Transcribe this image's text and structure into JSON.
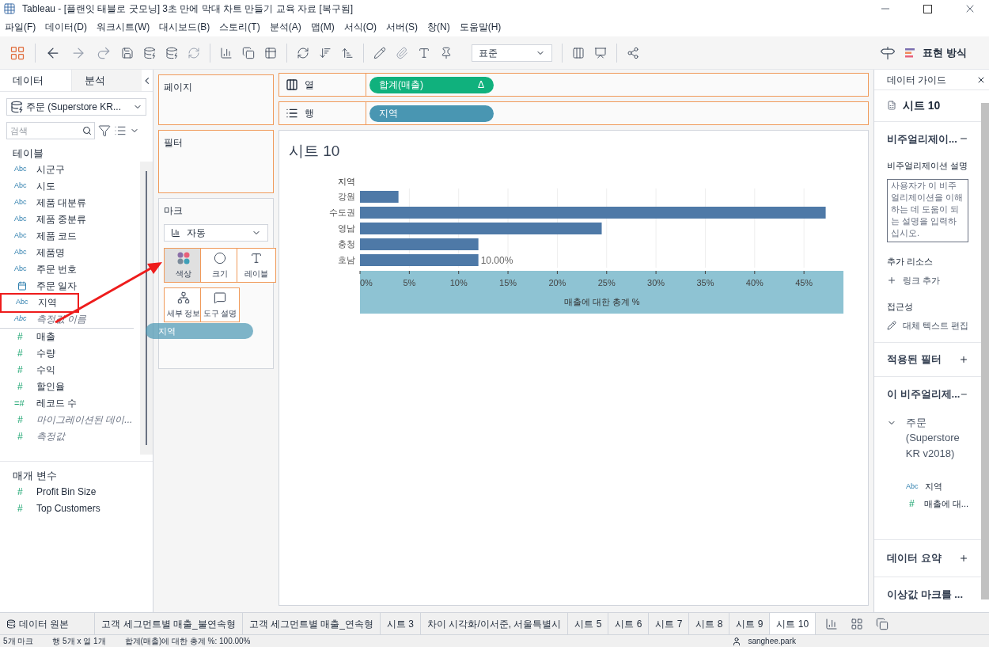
{
  "window": {
    "title": "Tableau - [플랜잇 태블로 굿모닝] 3초 만에 막대 차트 만들기 교육 자료 [복구됨]"
  },
  "menu": [
    "파일(F)",
    "데이터(D)",
    "워크시트(W)",
    "대시보드(B)",
    "스토리(T)",
    "분석(A)",
    "맵(M)",
    "서식(O)",
    "서버(S)",
    "창(N)",
    "도움말(H)"
  ],
  "toolbar": {
    "fit": "표준",
    "show_me": "표현 방식"
  },
  "data_pane": {
    "tabs": [
      {
        "label": "데이터",
        "selected": true
      },
      {
        "label": "분석",
        "selected": false
      }
    ],
    "datasource": "주문 (Superstore KR...",
    "search": {
      "placeholder": "검색"
    },
    "section": "테이블",
    "fields": [
      {
        "kind": "dimension",
        "glyph": "Abc",
        "name": "시군구",
        "italic": false,
        "highlighted": false
      },
      {
        "kind": "dimension",
        "glyph": "Abc",
        "name": "시도",
        "italic": false,
        "highlighted": false
      },
      {
        "kind": "dimension",
        "glyph": "Abc",
        "name": "제품 대분류",
        "italic": false,
        "highlighted": false
      },
      {
        "kind": "dimension",
        "glyph": "Abc",
        "name": "제품 중분류",
        "italic": false,
        "highlighted": false
      },
      {
        "kind": "dimension",
        "glyph": "Abc",
        "name": "제품 코드",
        "italic": false,
        "highlighted": false
      },
      {
        "kind": "dimension",
        "glyph": "Abc",
        "name": "제품명",
        "italic": false,
        "highlighted": false
      },
      {
        "kind": "dimension",
        "glyph": "Abc",
        "name": "주문 번호",
        "italic": false,
        "highlighted": false
      },
      {
        "kind": "date",
        "name": "주문 일자",
        "italic": false,
        "highlighted": false
      },
      {
        "kind": "dimension",
        "glyph": "Abc",
        "name": "지역",
        "italic": false,
        "highlighted": true
      },
      {
        "kind": "dimension",
        "glyph": "Abc",
        "name": "측정값 이름",
        "italic": true,
        "highlighted": false
      },
      {
        "kind": "measure",
        "glyph": "#",
        "name": "매출",
        "italic": false,
        "highlighted": false
      },
      {
        "kind": "measure",
        "glyph": "#",
        "name": "수량",
        "italic": false,
        "highlighted": false
      },
      {
        "kind": "measure",
        "glyph": "#",
        "name": "수익",
        "italic": false,
        "highlighted": false
      },
      {
        "kind": "measure",
        "glyph": "#",
        "name": "할인율",
        "italic": false,
        "highlighted": false
      },
      {
        "kind": "count",
        "glyph": "=#",
        "name": "레코드 수",
        "italic": false,
        "highlighted": false
      },
      {
        "kind": "measure",
        "glyph": "#",
        "name": "마이그레이션된 데이...",
        "italic": true,
        "highlighted": false
      },
      {
        "kind": "measure",
        "glyph": "#",
        "name": "측정값",
        "italic": true,
        "highlighted": false
      }
    ],
    "params_title": "매개 변수",
    "params": [
      {
        "kind": "measure",
        "glyph": "#",
        "name": "Profit Bin Size"
      },
      {
        "kind": "measure",
        "glyph": "#",
        "name": "Top Customers"
      }
    ]
  },
  "shelves": {
    "pages": "페이지",
    "filters": "필터",
    "columns": {
      "label": "열",
      "pill": {
        "text": "합계(매출)",
        "kind": "measure",
        "delta": "Δ"
      }
    },
    "rows": {
      "label": "행",
      "pill": {
        "text": "지역",
        "kind": "dimension"
      }
    }
  },
  "marks": {
    "title": "마크",
    "type": "자동",
    "cards": [
      {
        "kind": "color",
        "label": "색상"
      },
      {
        "kind": "size",
        "label": "크기"
      },
      {
        "kind": "label",
        "label": "레이블"
      },
      {
        "kind": "detail",
        "label": "세부 정보"
      },
      {
        "kind": "tooltip",
        "label": "도구 설명"
      }
    ],
    "drag_pill": "지역"
  },
  "sheet": {
    "title": "시트 10",
    "row_header": "지역",
    "chart_data": {
      "type": "bar",
      "orientation": "horizontal",
      "grid": true,
      "categories": [
        "강원",
        "수도권",
        "영남",
        "충청",
        "호남"
      ],
      "values": [
        3.9,
        47.2,
        24.5,
        12.0,
        12.0
      ],
      "xlabel": "매출에 대한 총계 %",
      "xlim": [
        0,
        49
      ],
      "xticks": [
        {
          "value": 0,
          "label": "0%"
        },
        {
          "value": 5,
          "label": "5%"
        },
        {
          "value": 10,
          "label": "10%"
        },
        {
          "value": 15,
          "label": "15%"
        },
        {
          "value": 20,
          "label": "20%"
        },
        {
          "value": 25,
          "label": "25%"
        },
        {
          "value": 30,
          "label": "30%"
        },
        {
          "value": 35,
          "label": "35%"
        },
        {
          "value": 40,
          "label": "40%"
        },
        {
          "value": 45,
          "label": "45%"
        }
      ]
    },
    "drop_label": "10.00%"
  },
  "guide": {
    "title": "데이터 가이드",
    "sheet": "시트 10",
    "viz_section": "비주얼리제이...",
    "desc_label": "비주얼리제이션 설명",
    "desc_placeholder": "사용자가 이 비주얼리제이션을 이해하는 데 도움이 되는 설명을 입력하십시오.",
    "resources": "추가 리소스",
    "add_link": "링크 추가",
    "access": "접근성",
    "alt_text": "대체 텍스트 편집",
    "filters": "적용된 필터",
    "this_viz": "이 비주얼리제...",
    "source": "주문 (Superstore KR v2018)",
    "source_fields": [
      {
        "kind": "dimension",
        "glyph": "Abc",
        "name": "지역"
      },
      {
        "kind": "measure",
        "glyph": "#",
        "name": "매출에 대..."
      }
    ],
    "summary": "데이터 요약",
    "outliers": "이상값 마크를 ..."
  },
  "sheet_tabs": [
    {
      "kind": "source",
      "label": "데이터 원본",
      "selected": false
    },
    {
      "kind": "sheet",
      "label": "고객 세그먼트별 매출_불연속형",
      "selected": false
    },
    {
      "kind": "sheet",
      "label": "고객 세그먼트별 매출_연속형",
      "selected": false
    },
    {
      "kind": "sheet",
      "label": "시트 3",
      "selected": false
    },
    {
      "kind": "sheet",
      "label": "차이 시각화/이서준, 서울특별시",
      "selected": false
    },
    {
      "kind": "sheet",
      "label": "시트 5",
      "selected": false
    },
    {
      "kind": "sheet",
      "label": "시트 6",
      "selected": false
    },
    {
      "kind": "sheet",
      "label": "시트 7",
      "selected": false
    },
    {
      "kind": "sheet",
      "label": "시트 8",
      "selected": false
    },
    {
      "kind": "sheet",
      "label": "시트 9",
      "selected": false
    },
    {
      "kind": "sheet",
      "label": "시트 10",
      "selected": true
    }
  ],
  "status": {
    "marks": "5개 마크",
    "dims": "행 5개 x 열 1개",
    "sum": "합계(매출)에 대한 총계 %: 100.00%",
    "user": "sanghee.park"
  }
}
